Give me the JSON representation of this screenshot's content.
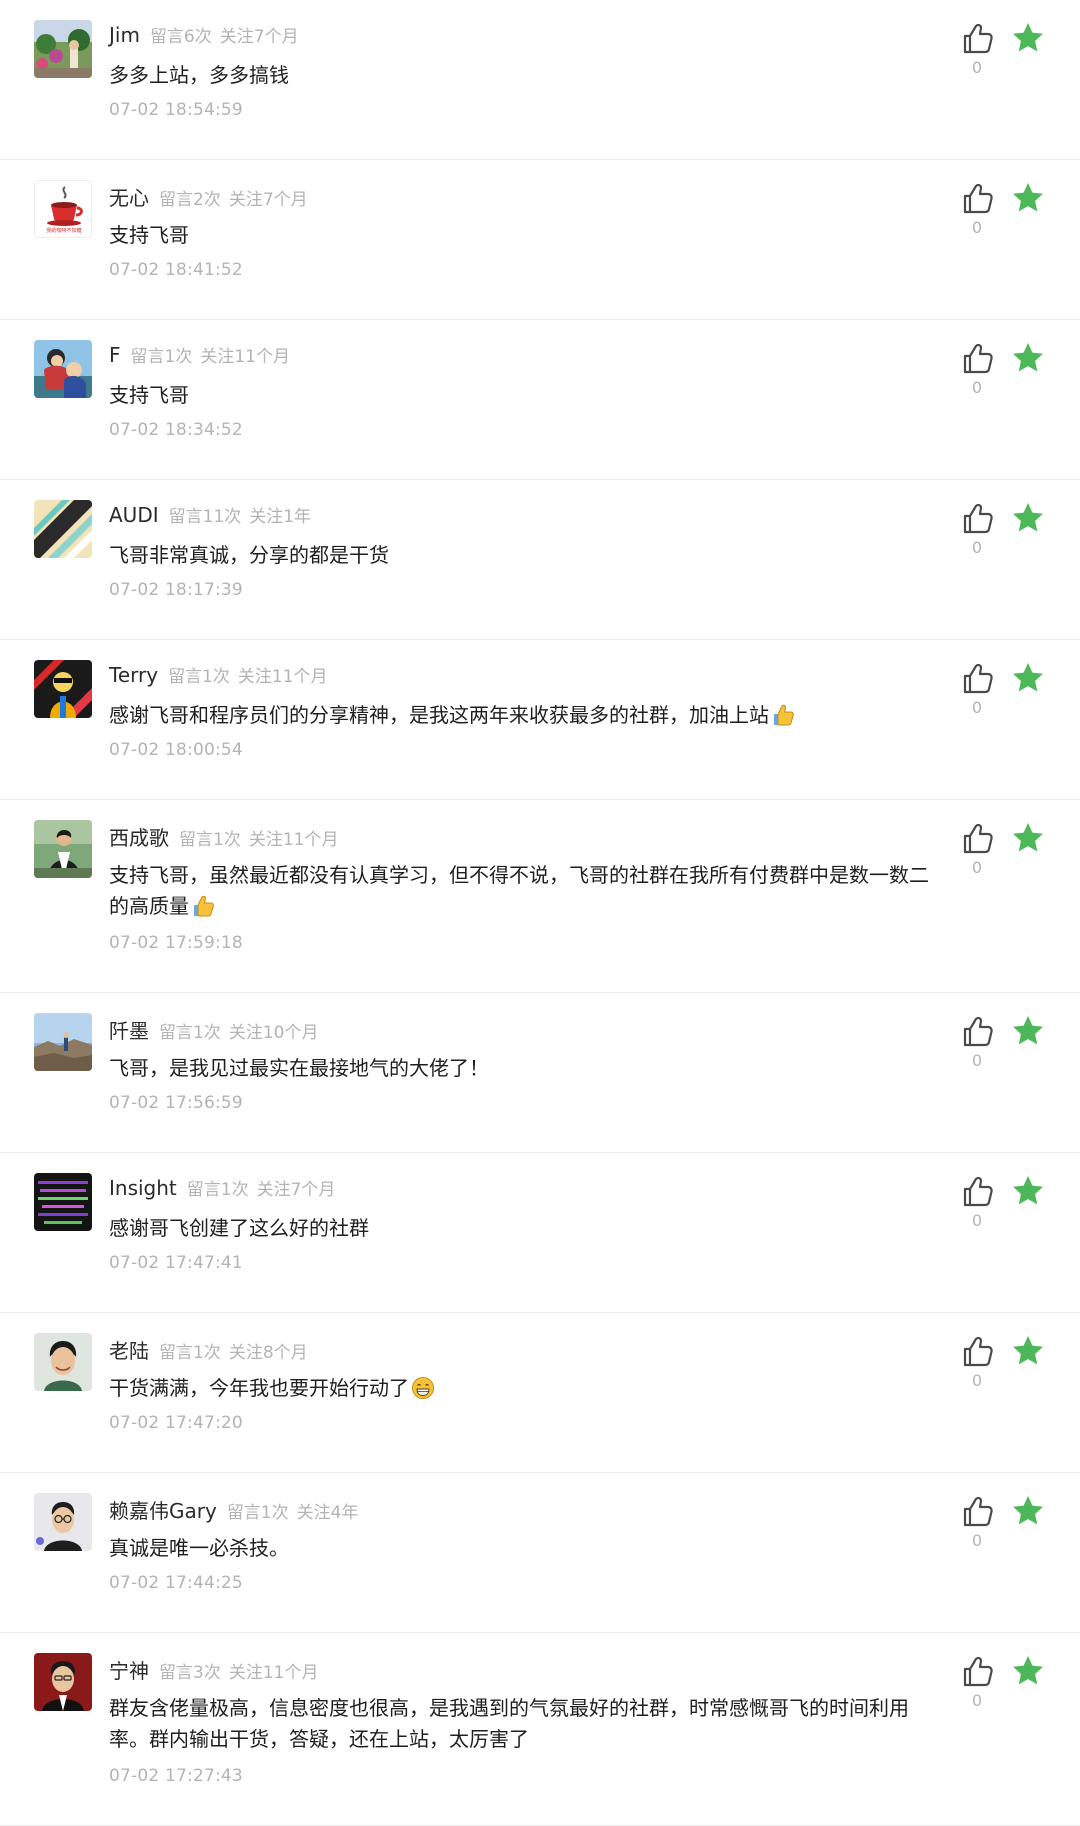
{
  "comments": [
    {
      "nick": "Jim",
      "count": "留言6次",
      "follow": "关注7个月",
      "content": "多多上站，多多搞钱",
      "time": "07-02 18:54:59",
      "likes": "0",
      "emoji": ""
    },
    {
      "nick": "无心",
      "count": "留言2次",
      "follow": "关注7个月",
      "content": "支持飞哥",
      "time": "07-02 18:41:52",
      "likes": "0",
      "emoji": ""
    },
    {
      "nick": "F",
      "count": "留言1次",
      "follow": "关注11个月",
      "content": "支持飞哥",
      "time": "07-02 18:34:52",
      "likes": "0",
      "emoji": ""
    },
    {
      "nick": "AUDI",
      "count": "留言11次",
      "follow": "关注1年",
      "content": "飞哥非常真诚，分享的都是干货",
      "time": "07-02 18:17:39",
      "likes": "0",
      "emoji": ""
    },
    {
      "nick": "Terry",
      "count": "留言1次",
      "follow": "关注11个月",
      "content": "感谢飞哥和程序员们的分享精神，是我这两年来收获最多的社群，加油上站",
      "time": "07-02 18:00:54",
      "likes": "0",
      "emoji": "thumbs-up-emoji"
    },
    {
      "nick": "西成歌",
      "count": "留言1次",
      "follow": "关注11个月",
      "content": "支持飞哥，虽然最近都没有认真学习，但不得不说，飞哥的社群在我所有付费群中是数一数二的高质量",
      "time": "07-02 17:59:18",
      "likes": "0",
      "emoji": "thumbs-up-emoji"
    },
    {
      "nick": "阡墨",
      "count": "留言1次",
      "follow": "关注10个月",
      "content": "飞哥，是我见过最实在最接地气的大佬了！",
      "time": "07-02 17:56:59",
      "likes": "0",
      "emoji": ""
    },
    {
      "nick": "Insight",
      "count": "留言1次",
      "follow": "关注7个月",
      "content": "感谢哥飞创建了这么好的社群",
      "time": "07-02 17:47:41",
      "likes": "0",
      "emoji": ""
    },
    {
      "nick": "老陆",
      "count": "留言1次",
      "follow": "关注8个月",
      "content": "干货满满，今年我也要开始行动了",
      "time": "07-02 17:47:20",
      "likes": "0",
      "emoji": "grin-emoji"
    },
    {
      "nick": "赖嘉伟Gary",
      "count": "留言1次",
      "follow": "关注4年",
      "content": "真诚是唯一必杀技。",
      "time": "07-02 17:44:25",
      "likes": "0",
      "emoji": ""
    },
    {
      "nick": "宁神",
      "count": "留言3次",
      "follow": "关注11个月",
      "content": "群友含佬量极高，信息密度也很高，是我遇到的气氛最好的社群，时常感慨哥飞的时间利用率。群内输出干货，答疑，还在上站，太厉害了",
      "time": "07-02 17:27:43",
      "likes": "0",
      "emoji": ""
    }
  ],
  "avatar_label_2": "我的咖啡不加糖",
  "colors": {
    "star": "#4cb85a",
    "muted": "#b3b3b3",
    "divider": "#e9e9e9",
    "icon": "#4a4a4a"
  }
}
